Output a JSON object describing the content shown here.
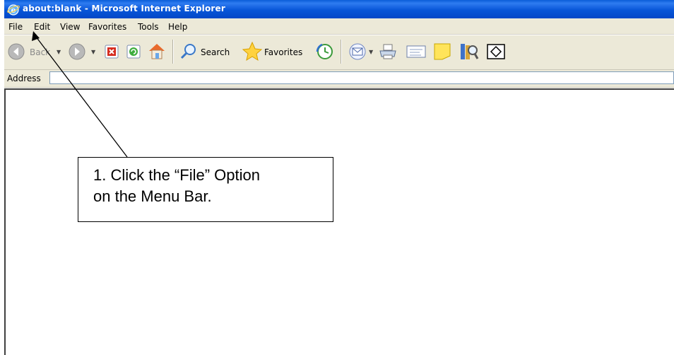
{
  "window": {
    "title": "about:blank - Microsoft Internet Explorer"
  },
  "menu": {
    "items": [
      "File",
      "Edit",
      "View",
      "Favorites",
      "Tools",
      "Help"
    ]
  },
  "toolbar": {
    "back_label": "Back",
    "search_label": "Search",
    "favorites_label": "Favorites"
  },
  "address": {
    "label": "Address",
    "value": ""
  },
  "callout": {
    "line1": "1. Click the “File” Option",
    "line2": "on the Menu Bar."
  },
  "colors": {
    "titlebar": "#0a5ed8",
    "chrome": "#ece9d8"
  }
}
